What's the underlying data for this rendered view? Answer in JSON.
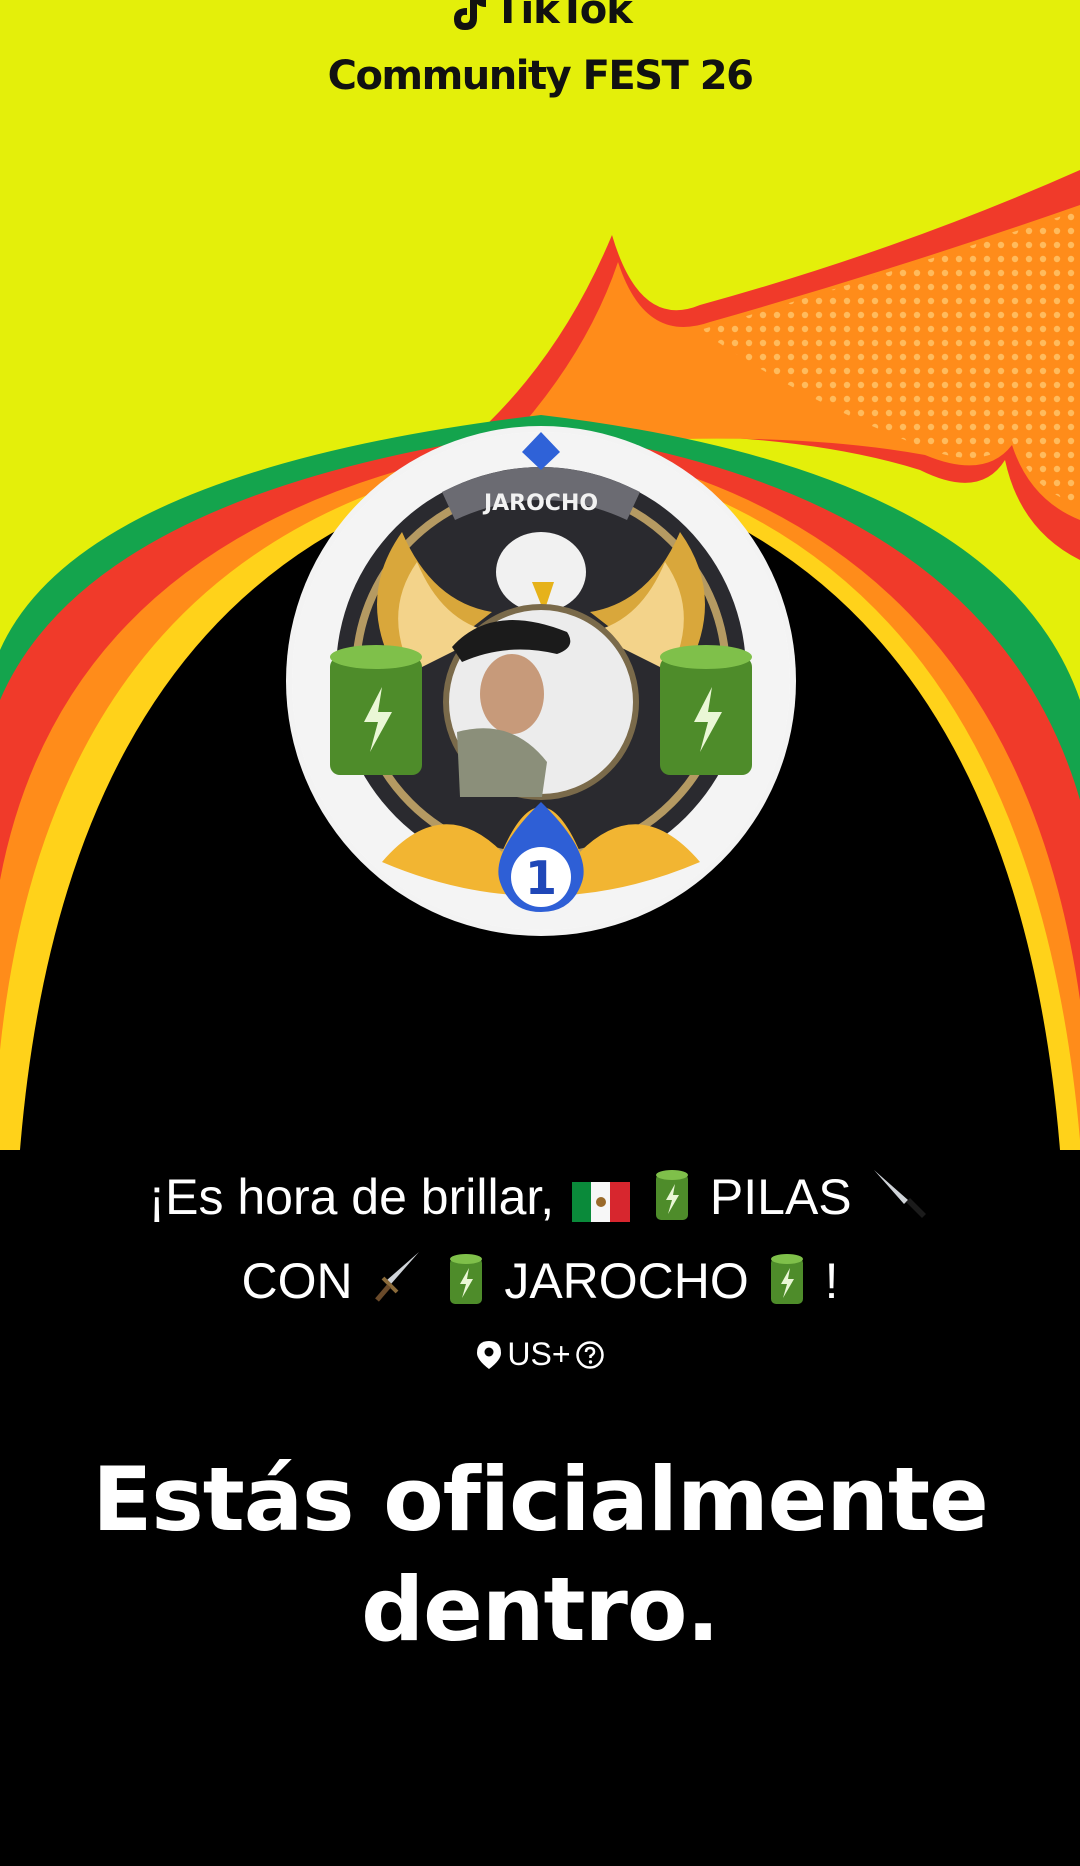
{
  "header": {
    "brand_name": "TikTok",
    "event_title": "Community FEST 26"
  },
  "avatar": {
    "frame_label": "JAROCHO",
    "rank_number": "1"
  },
  "profile": {
    "greeting_prefix": "¡Es hora de brillar,",
    "name_part_pilas": "PILAS",
    "name_part_con": "CON",
    "name_part_jarocho": "JAROCHO",
    "greeting_suffix": "!",
    "emojis": [
      "mexico-flag",
      "battery",
      "knife",
      "dagger",
      "battery",
      "battery"
    ]
  },
  "location": {
    "region": "US+"
  },
  "headline": {
    "line1": "Estás oficialmente",
    "line2": "dentro."
  },
  "colors": {
    "background_yellow": "#e4ef0a",
    "arch_green": "#14a44d",
    "arch_red": "#f03a2a",
    "arch_orange": "#ff8c1a",
    "arch_yellow": "#ffd21a",
    "text_white": "#ffffff"
  }
}
